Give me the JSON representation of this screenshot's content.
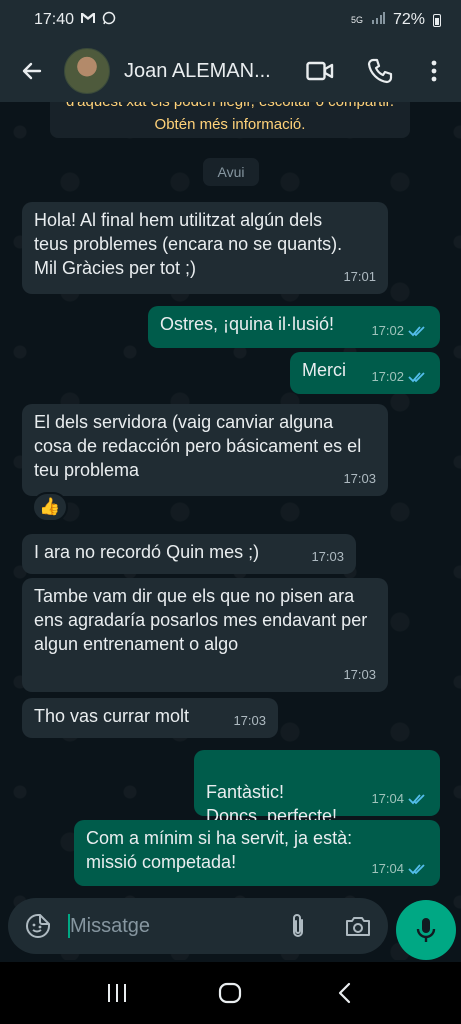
{
  "status": {
    "time": "17:40",
    "network": "5G",
    "battery": "72%"
  },
  "header": {
    "contact_name": "Joan ALEMAN..."
  },
  "chat": {
    "encryption_note": "d'aquest xat els poden llegir, escoltar o compartir. Obtén més informació.",
    "date_chip": "Avui",
    "reaction": "👍",
    "messages": [
      {
        "direction": "in",
        "text": "Hola! Al final hem utilitzat algún dels teus problemes (encara no se quants). Mil Gràcies per tot ;)",
        "time": "17:01"
      },
      {
        "direction": "out",
        "text": "Ostres, ¡quina il·lusió!",
        "time": "17:02",
        "status": "read"
      },
      {
        "direction": "out",
        "text": "Merci",
        "time": "17:02",
        "status": "read"
      },
      {
        "direction": "in",
        "text": "El dels servidora (vaig canviar alguna cosa de redacción pero básicament es el teu problema",
        "time": "17:03"
      },
      {
        "direction": "in",
        "text": "I ara no recordó Quin mes ;)",
        "time": "17:03"
      },
      {
        "direction": "in",
        "text": "Tambe vam dir que els que no pisen ara ens agradaría posarlos mes endavant per algun entrenament o algo",
        "time": "17:03"
      },
      {
        "direction": "in",
        "text": "Tho vas currar molt",
        "time": "17:03"
      },
      {
        "direction": "out",
        "text": "Fantàstic!\nDoncs, perfecte!",
        "time": "17:04",
        "status": "read"
      },
      {
        "direction": "out",
        "text": "Com a mínim si ha servit, ja està: missió competada!",
        "time": "17:04",
        "status": "read"
      }
    ]
  },
  "composer": {
    "placeholder": "Missatge"
  },
  "colors": {
    "incoming_bubble": "#202c33",
    "outgoing_bubble": "#005c4b",
    "accent": "#00a884",
    "read_ticks": "#53bdeb"
  }
}
